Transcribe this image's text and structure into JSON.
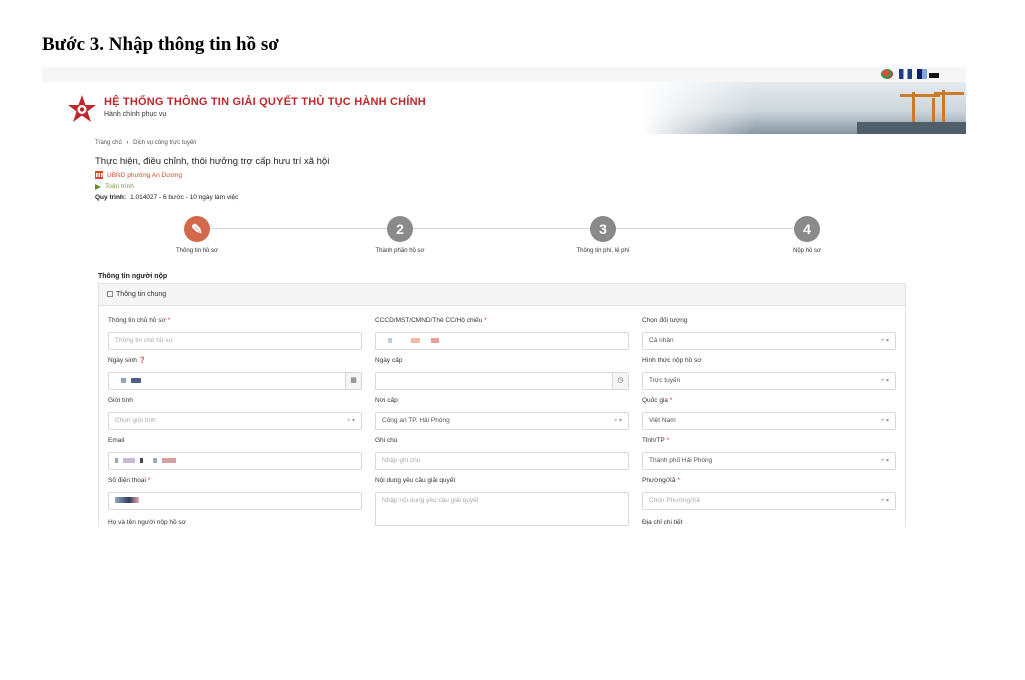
{
  "doc_heading": "Bước 3. Nhập thông tin hồ sơ",
  "portal": {
    "title": "HỆ THỐNG THÔNG TIN GIẢI QUYẾT THỦ TỤC HÀNH CHÍNH",
    "subtitle": "Hành chính phục vụ"
  },
  "breadcrumb": {
    "home": "Trang chủ",
    "current": "Dịch vụ công trực tuyến",
    "separator": "›"
  },
  "procedure": {
    "title": "Thực hiện, điều chỉnh, thôi hưởng trợ cấp hưu trí xã hội",
    "agency": "UBND phường An Dương",
    "scope": "Toàn trình",
    "steps_label": "Quy trình:",
    "steps_value": "1.014027 - 6 bước - 10 ngày làm việc"
  },
  "stepper": [
    {
      "number": "✎",
      "label": "Thông tin hồ sơ",
      "active": true
    },
    {
      "number": "2",
      "label": "Thành phần hồ sơ",
      "active": false
    },
    {
      "number": "3",
      "label": "Thông tin phí, lệ phí",
      "active": false
    },
    {
      "number": "4",
      "label": "Nộp hồ sơ",
      "active": false
    }
  ],
  "applicant_section": "Thông tin người nộp",
  "general_panel": "Thông tin chung",
  "form": {
    "owner": {
      "label": "Thông tin chủ hồ sơ",
      "required": "*",
      "placeholder": "Thông tin chủ hồ sơ"
    },
    "id_number": {
      "label": "CCCD/MST/CMND/Thẻ CC/Hộ chiếu",
      "required": "*"
    },
    "subject": {
      "label": "Chọn đối tượng",
      "value": "Cá nhân",
      "icons": "× ▾"
    },
    "dob": {
      "label": "Ngày sinh",
      "help": "❓",
      "icon": "▦"
    },
    "issue_date": {
      "label": "Ngày cấp",
      "icon": "◷"
    },
    "submit_method": {
      "label": "Hình thức nộp hồ sơ",
      "value": "Trực tuyến",
      "icons": "× ▾"
    },
    "gender": {
      "label": "Giới tính",
      "placeholder": "Chọn giới tính",
      "icons": "× ▾"
    },
    "issue_place": {
      "label": "Nơi cấp",
      "value": "Công an TP. Hải Phòng",
      "icons": "× ▾"
    },
    "country": {
      "label": "Quốc gia",
      "required": "*",
      "value": "Việt Nam",
      "icons": "× ▾"
    },
    "email": {
      "label": "Email"
    },
    "note": {
      "label": "Ghi chú",
      "placeholder": "Nhập ghi chú"
    },
    "province": {
      "label": "Tỉnh/TP",
      "required": "*",
      "value": "Thành phố Hải Phòng",
      "icons": "× ▾"
    },
    "phone": {
      "label": "Số điện thoại",
      "required": "*"
    },
    "request_content": {
      "label": "Nội dung yêu cầu giải quyết",
      "placeholder": "Nhập nội dung yêu cầu giải quyết"
    },
    "ward": {
      "label": "Phường/Xã",
      "required": "*",
      "placeholder": "Chọn Phường/Xã",
      "icons": "× ▾"
    },
    "submitter_name": {
      "label": "Họ và tên người nộp hồ sơ"
    },
    "address": {
      "label": "Địa chỉ chi tiết"
    }
  },
  "colors": {
    "brand_red": "#c0262b",
    "active_step": "#d2694a",
    "inactive_step": "#8a8a8a",
    "required": "#d9302c"
  }
}
